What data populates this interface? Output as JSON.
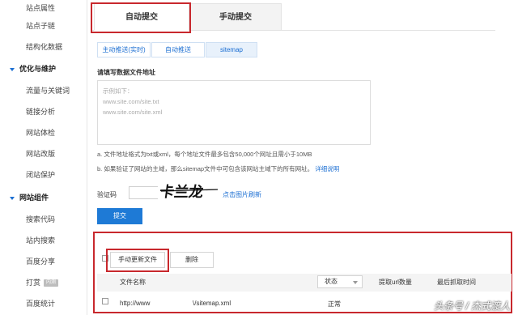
{
  "sidebar": {
    "items_top": [
      "站点属性",
      "站点子链",
      "结构化数据"
    ],
    "section_opt": "优化与维护",
    "items_opt": [
      "流量与关键词",
      "链接分析",
      "网站体检",
      "网站改版",
      "闭站保护"
    ],
    "section_widgets": "网站组件",
    "items_widgets": [
      "搜索代码",
      "站内搜索",
      "百度分享",
      "打赏",
      "百度统计"
    ],
    "badge_dashang": "内测"
  },
  "tabs": {
    "auto": "自动提交",
    "manual": "手动提交"
  },
  "subtabs": [
    "主动推送(实时)",
    "自动推送",
    "sitemap"
  ],
  "form": {
    "label": "请填写数据文件地址",
    "example_title": "示例如下：",
    "example_1": "www.site.com/site.txt",
    "example_2": "www.site.com/site.xml",
    "note_a": "a. 文件地址格式为txt或xml，每个地址文件最多包含50,000个网址且需小于10MB",
    "note_b": "b. 如果验证了网站的主域，那么sitemap文件中可包含该网站主域下的所有网址。",
    "note_b_link": "详细说明",
    "captcha_label": "验证码",
    "captcha_text": "卡兰龙",
    "captcha_refresh": "点击图片刷新",
    "submit": "提交"
  },
  "toolbar": {
    "update": "手动更新文件",
    "delete": "删除"
  },
  "table": {
    "headers": {
      "file": "文件名称",
      "status": "状态",
      "count": "提取url数量",
      "last_time": "最后抓取时间"
    },
    "rows": [
      {
        "file_prefix": "http://www",
        "file_suffix": "\\/sitemap.xml",
        "status": "正常"
      }
    ]
  },
  "watermark": "头条号 / 杰式渡人"
}
